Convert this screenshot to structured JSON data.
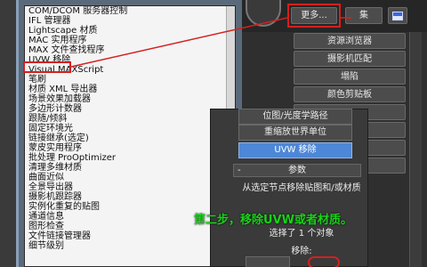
{
  "material_list": {
    "items": [
      "COM/DCOM 服务器控制",
      "IFL 管理器",
      "Lightscape 材质",
      "MAC 实用程序",
      "MAX 文件查找程序",
      "UVW 移除",
      "Visual MAXScript",
      "笔刷",
      "材质 XML 导出器",
      "场景效果加载器",
      "多边形计数器",
      "跟随/倾斜",
      "固定环境光",
      "链接继承(选定)",
      "蒙皮实用程序",
      "批处理 ProOptimizer",
      "清理多维材质",
      "曲面近似",
      "全景导出器",
      "摄影机跟踪器",
      "实例化重复的贴图",
      "通道信息",
      "图形检查",
      "文件链接管理器",
      "细节级别"
    ],
    "selected_index": 5
  },
  "utility_toolbar": {
    "more_label": "更多...",
    "set_label": "集"
  },
  "utility_buttons": [
    "资源浏览器",
    "摄影机匹配",
    "塌陷",
    "颜色剪贴板"
  ],
  "float_panel": {
    "buttons": [
      "位图/光度学路径",
      "重缩放世界单位",
      "UVW 移除"
    ],
    "rollout_minus": "-",
    "rollout_title": "参数",
    "description": "从选定节点移除贴图和/或材质",
    "status": "选择了 1 个对象",
    "remove_label": "移除:"
  },
  "annotation": "第二步，移除UVW或者材质。",
  "colors": {
    "highlight_red": "#d42020",
    "selected_blue": "#4d87d8",
    "annotation_green": "#18d418"
  }
}
